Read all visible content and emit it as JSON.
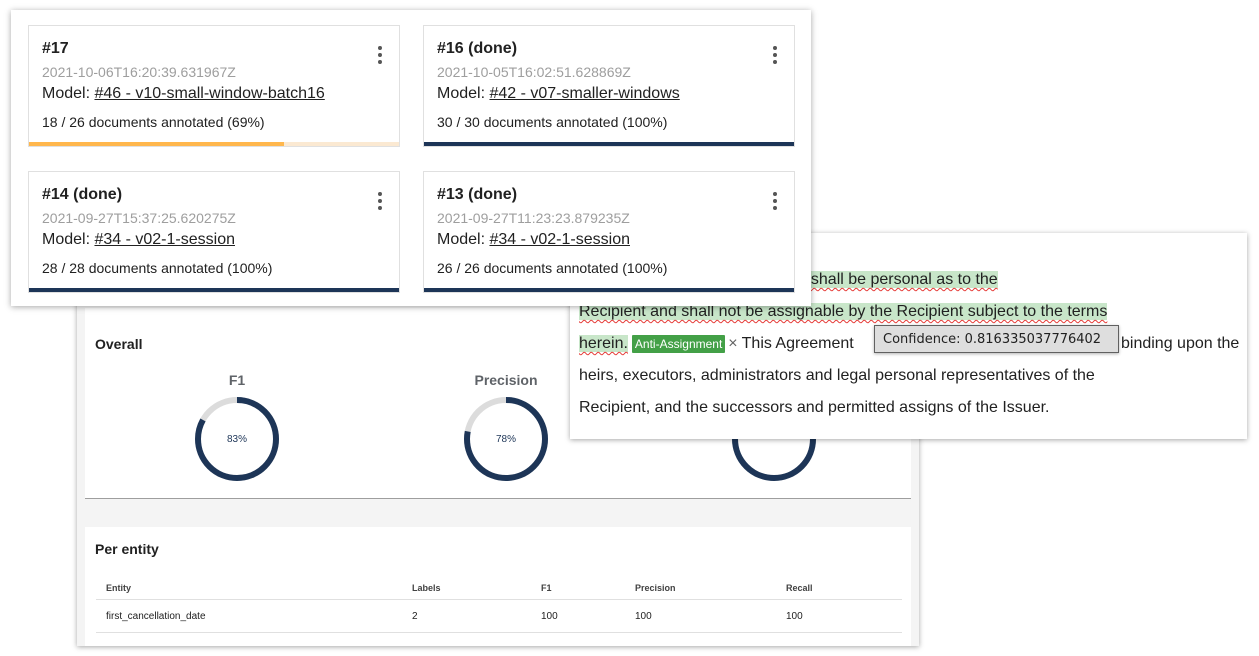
{
  "annotation_sets": [
    {
      "id": "#17",
      "timestamp": "2021-10-06T16:20:39.631967Z",
      "model_prefix": "Model: ",
      "model_link": "#46 - v10-small-window-batch16",
      "progress": "18 / 26 documents annotated (69%)",
      "progress_fraction": 0.69,
      "bar_color": "#ffb74d",
      "bar_track": "#fbe9d2"
    },
    {
      "id": "#16 (done)",
      "timestamp": "2021-10-05T16:02:51.628869Z",
      "model_prefix": "Model: ",
      "model_link": "#42 - v07-smaller-windows",
      "progress": "30 / 30 documents annotated (100%)",
      "progress_fraction": 1.0,
      "bar_color": "#1d3557",
      "bar_track": "#1d3557"
    },
    {
      "id": "#14 (done)",
      "timestamp": "2021-09-27T15:37:25.620275Z",
      "model_prefix": "Model: ",
      "model_link": "#34 - v02-1-session",
      "progress": "28 / 28 documents annotated (100%)",
      "progress_fraction": 1.0,
      "bar_color": "#1d3557",
      "bar_track": "#1d3557"
    },
    {
      "id": "#13 (done)",
      "timestamp": "2021-09-27T11:23:23.879235Z",
      "model_prefix": "Model: ",
      "model_link": "#34 - v02-1-session",
      "progress": "26 / 26 documents annotated (100%)",
      "progress_fraction": 1.0,
      "bar_color": "#1d3557",
      "bar_track": "#1d3557"
    }
  ],
  "text_panel": {
    "line1_hl": "t shall be personal as to the",
    "line2_hl": "Recipient and shall not be assignable by the Recipient subject to the terms",
    "line3_hl": "herein.",
    "tag_label": "Anti-Assignment",
    "tag_close": "×",
    "line3_rest": "This Agreement",
    "line3_tail": "binding upon the",
    "line4": "heirs, executors, administrators and legal personal representatives of the",
    "line5": "Recipient, and the successors and permitted assigns of the Issuer.",
    "tooltip": "Confidence: 0.816335037776402",
    "highlight_color": "#c8e6c9",
    "tag_color": "#43a047"
  },
  "overall": {
    "title": "Overall",
    "metrics": [
      {
        "label": "F1",
        "value_text": "83%",
        "value": 0.83
      },
      {
        "label": "Precision",
        "value_text": "78%",
        "value": 0.78
      },
      {
        "label": "",
        "value_text": "",
        "value": 0.92
      }
    ],
    "ring_color": "#1d3557",
    "ring_track": "#dcdcdc"
  },
  "per_entity": {
    "title": "Per entity",
    "headers": [
      "Entity",
      "Labels",
      "F1",
      "Precision",
      "Recall"
    ],
    "rows": [
      [
        "first_cancellation_date",
        "2",
        "100",
        "100",
        "100"
      ]
    ]
  }
}
